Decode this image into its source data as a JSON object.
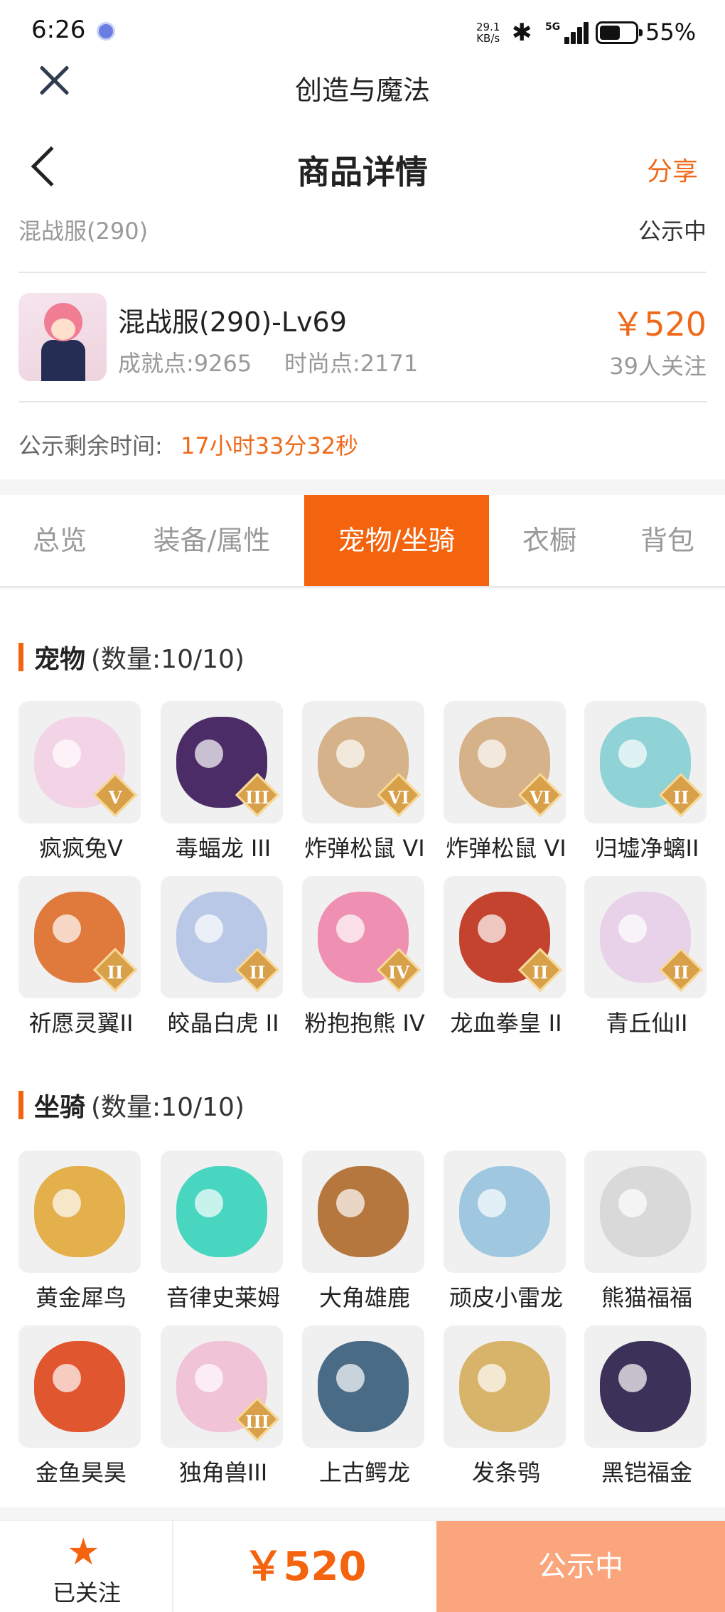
{
  "status_bar": {
    "time": "6:26",
    "speed_value": "29.1",
    "speed_unit": "KB/s",
    "network": "5G",
    "battery": "55%",
    "battery_level": 0.55
  },
  "app": {
    "title": "创造与魔法"
  },
  "header": {
    "title": "商品详情",
    "share": "分享",
    "server": "混战服(290)",
    "status": "公示中"
  },
  "item": {
    "name": "混战服(290)-Lv69",
    "achievement": "成就点:9265",
    "fashion": "时尚点:2171",
    "price": "￥520",
    "followers": "39人关注",
    "countdown_label": "公示剩余时间:",
    "countdown_value": "17小时33分32秒"
  },
  "tabs": [
    "总览",
    "装备/属性",
    "宠物/坐骑",
    "衣橱",
    "背包"
  ],
  "active_tab": 2,
  "pets": {
    "title": "宠物",
    "count": "(数量:10/10)",
    "items": [
      {
        "name": "疯疯兔V",
        "rank": "V",
        "color": "#f3d4e6"
      },
      {
        "name": "毒蝠龙 III",
        "rank": "III",
        "color": "#4b2c66"
      },
      {
        "name": "炸弹松鼠 VI",
        "rank": "VI",
        "color": "#d6b28a"
      },
      {
        "name": "炸弹松鼠 VI",
        "rank": "VI",
        "color": "#d6b28a"
      },
      {
        "name": "归墟净螭II",
        "rank": "II",
        "color": "#8fd3d6"
      },
      {
        "name": "祈愿灵翼II",
        "rank": "II",
        "color": "#e07a3c"
      },
      {
        "name": "皎晶白虎 II",
        "rank": "II",
        "color": "#b8c8e6"
      },
      {
        "name": "粉抱抱熊 IV",
        "rank": "IV",
        "color": "#ef8fb2"
      },
      {
        "name": "龙血拳皇 II",
        "rank": "II",
        "color": "#c4432e"
      },
      {
        "name": "青丘仙II",
        "rank": "II",
        "color": "#e8d2ea"
      }
    ]
  },
  "mounts": {
    "title": "坐骑",
    "count": "(数量:10/10)",
    "items": [
      {
        "name": "黄金犀鸟",
        "rank": "",
        "color": "#e3b04b"
      },
      {
        "name": "音律史莱姆",
        "rank": "",
        "color": "#49d6c0"
      },
      {
        "name": "大角雄鹿",
        "rank": "",
        "color": "#b5773e"
      },
      {
        "name": "顽皮小雷龙",
        "rank": "",
        "color": "#9fc8e0"
      },
      {
        "name": "熊猫福福",
        "rank": "",
        "color": "#d9d9d9"
      },
      {
        "name": "金鱼昊昊",
        "rank": "",
        "color": "#e0562f"
      },
      {
        "name": "独角兽III",
        "rank": "III",
        "color": "#f0c3d6"
      },
      {
        "name": "上古鳄龙",
        "rank": "",
        "color": "#4a6b86"
      },
      {
        "name": "发条鸮",
        "rank": "",
        "color": "#d8b46a"
      },
      {
        "name": "黑铠福金",
        "rank": "",
        "color": "#3c3158"
      }
    ]
  },
  "footer": {
    "follow_label": "已关注",
    "price": "￥520",
    "action": "公示中"
  },
  "colors": {
    "accent": "#f4630d",
    "accent_light": "#faa57b",
    "price": "#ee6a1a"
  }
}
